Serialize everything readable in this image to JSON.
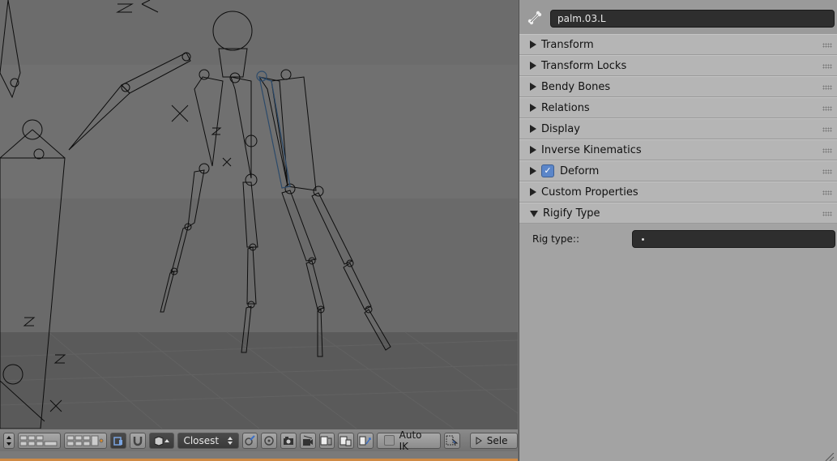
{
  "bone": {
    "name": "palm.03.L"
  },
  "sections": [
    {
      "label": "Transform",
      "expanded": false
    },
    {
      "label": "Transform Locks",
      "expanded": false
    },
    {
      "label": "Bendy Bones",
      "expanded": false
    },
    {
      "label": "Relations",
      "expanded": false
    },
    {
      "label": "Display",
      "expanded": false
    },
    {
      "label": "Inverse Kinematics",
      "expanded": false
    },
    {
      "label": "Deform",
      "expanded": false,
      "checked": true
    },
    {
      "label": "Custom Properties",
      "expanded": false
    },
    {
      "label": "Rigify Type",
      "expanded": true
    }
  ],
  "rigify": {
    "rig_type_label": "Rig type::",
    "rig_type_value": ""
  },
  "toolbar": {
    "snap_element": "Closest",
    "auto_ik_label": "Auto IK",
    "auto_ik_checked": false,
    "select_label": "Sele"
  },
  "colors": {
    "panel_bg": "#a3a3a3",
    "section_bg": "#b5b5b5",
    "field_bg": "#2e2e2e",
    "checkbox_blue": "#5b86c9",
    "viewport_bg": "#767676",
    "timeline_orange": "#cf8a45"
  },
  "icons": [
    "bone-icon",
    "expand-triangle-icon",
    "drag-grip-icon",
    "checkbox-icon",
    "layer-grid-icon",
    "snap-icon",
    "shading-icon",
    "render-icon",
    "camera-icon",
    "copy-pose-icon",
    "paste-pose-icon",
    "flip-pose-icon",
    "select-icon"
  ]
}
